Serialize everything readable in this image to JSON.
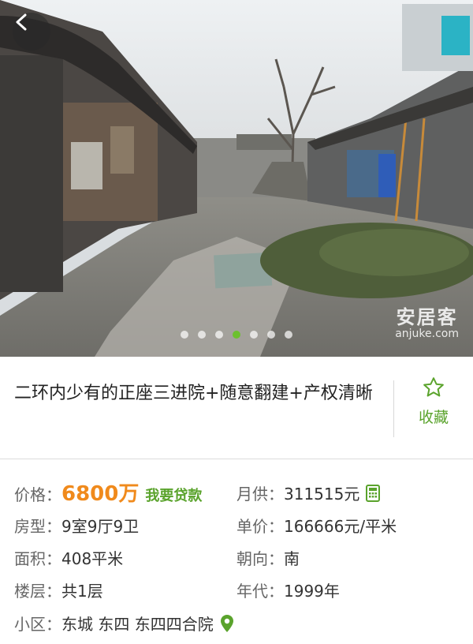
{
  "hero": {
    "watermark_cn": "安居客",
    "watermark_en": "anjuke.com",
    "carousel_count": 7,
    "carousel_active": 4
  },
  "listing": {
    "title": "二环内少有的正座三进院+随意翻建+产权清晰",
    "favorite_label": "收藏"
  },
  "info": {
    "price_label": "价格：",
    "price_value": "6800万",
    "loan_link": "我要贷款",
    "monthly_label": "月供：",
    "monthly_value": "311515元",
    "layout_label": "房型：",
    "layout_value": "9室9厅9卫",
    "unit_price_label": "单价：",
    "unit_price_value": "166666元/平米",
    "area_label": "面积：",
    "area_value": "408平米",
    "orientation_label": "朝向：",
    "orientation_value": "南",
    "floor_label": "楼层：",
    "floor_value": "共1层",
    "year_label": "年代：",
    "year_value": "1999年",
    "community_label": "小区：",
    "community_value": "东城 东四 东四四合院"
  },
  "colors": {
    "accent_green": "#5aa32c",
    "price_orange": "#f08a1c"
  },
  "icons": [
    "back-arrow-icon",
    "star-outline-icon",
    "calculator-icon",
    "location-pin-icon"
  ]
}
